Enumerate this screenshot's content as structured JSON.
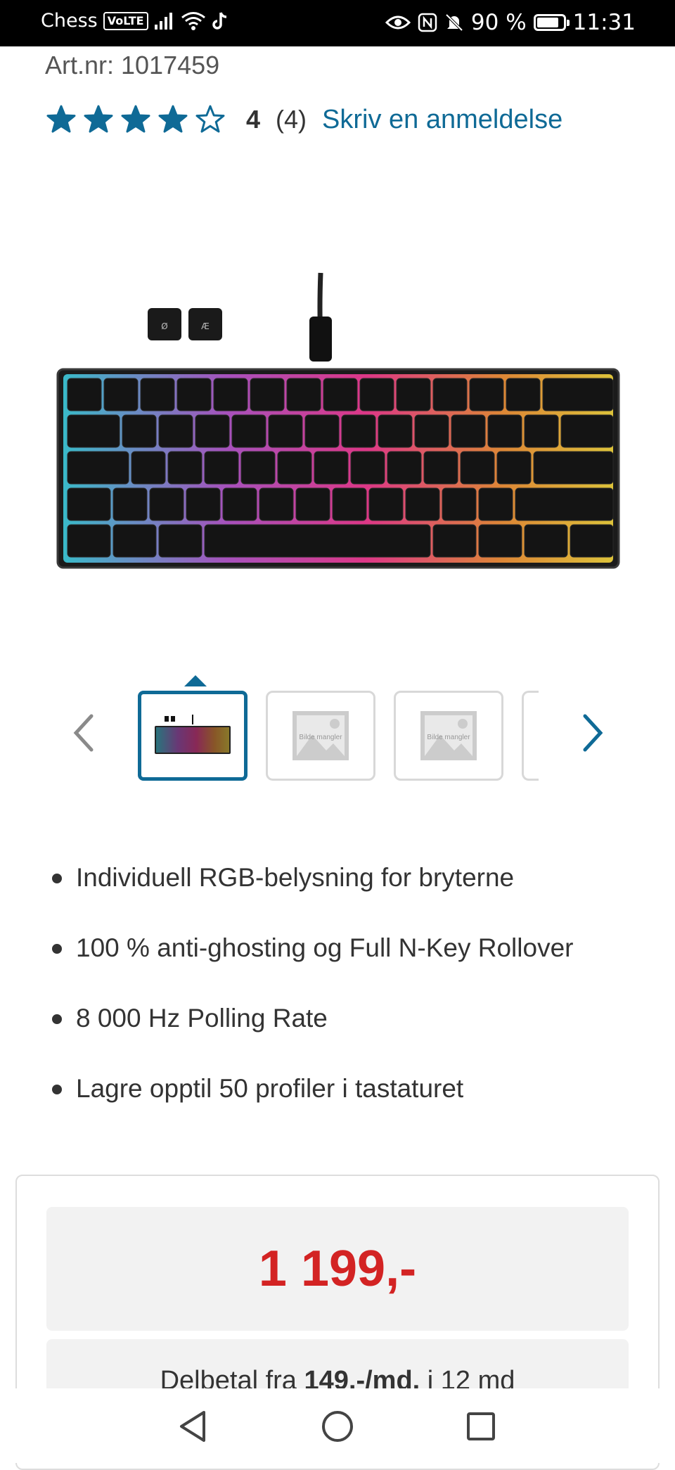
{
  "status_bar": {
    "carrier": "Chess",
    "volte": "VoLTE",
    "battery_percent": "90 %",
    "battery_level": 0.9,
    "time": "11:31",
    "icons": [
      "signal-icon",
      "wifi-icon",
      "tiktok-icon",
      "eye-icon",
      "nfc-icon",
      "mute-icon",
      "battery-icon"
    ]
  },
  "product": {
    "art_nr": "Art.nr: 1017459",
    "rating": {
      "stars_filled": 4,
      "stars_total": 5,
      "score": "4",
      "count": "(4)",
      "review_link": "Skriv en anmeldelse"
    },
    "accent_color": "#0f6a96",
    "image": {
      "description": "RGB keyboard product image"
    },
    "thumbnails": {
      "placeholder_text": "Bilde mangler",
      "prev_icon": "chevron-left-icon",
      "next_icon": "chevron-right-icon"
    },
    "features": [
      "Individuell RGB-belysning for bryterne",
      "100 % anti-ghosting og Full N-Key Rollover",
      "8 000 Hz Polling Rate",
      "Lagre opptil 50 profiler i tastaturet"
    ],
    "price": "1 199,-",
    "price_color": "#d32323",
    "installment": {
      "prefix": "Delbetal fra ",
      "amount": "149,-/md.",
      "suffix": " i 12 md"
    }
  },
  "nav_bar": {
    "icons": [
      "back-icon",
      "home-icon",
      "recents-icon"
    ]
  }
}
